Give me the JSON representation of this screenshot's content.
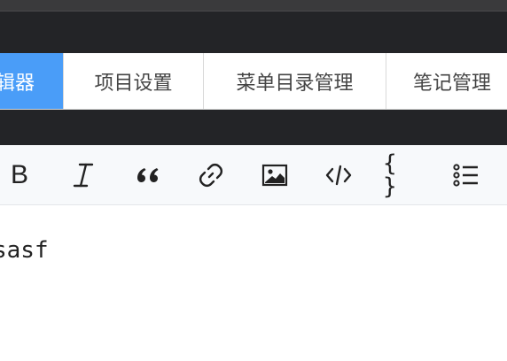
{
  "tabs": [
    {
      "label": "编辑器",
      "active": true
    },
    {
      "label": "项目设置",
      "active": false
    },
    {
      "label": "菜单目录管理",
      "active": false
    },
    {
      "label": "笔记管理",
      "active": false
    }
  ],
  "toolbar": {
    "bold_label": "B",
    "code_block_label": "{ }",
    "icons": [
      "bold-icon",
      "italic-icon",
      "quote-icon",
      "link-icon",
      "image-icon",
      "code-icon",
      "code-block-icon",
      "list-icon"
    ]
  },
  "editor": {
    "content": "sasf"
  },
  "colors": {
    "accent": "#4a9df8",
    "dark_band": "#232427",
    "toolbar_bg": "#f7f9fb"
  }
}
